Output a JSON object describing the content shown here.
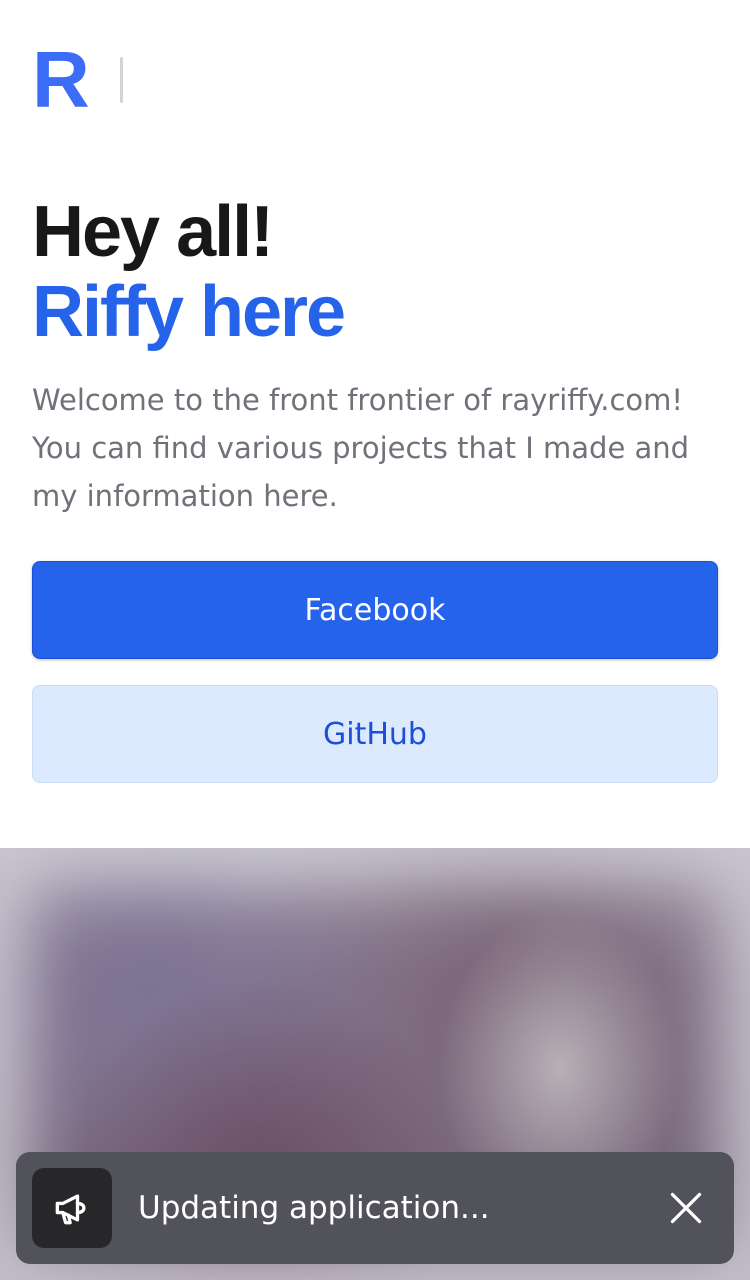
{
  "header": {
    "logo_letter": "R",
    "logo_color": "#3b6df6"
  },
  "hero": {
    "title_line1": "Hey all!",
    "title_line2": "Riffy here",
    "description": "Welcome to the front frontier of rayriffy.com! You can find various projects that I made and my information here."
  },
  "buttons": {
    "facebook_label": "Facebook",
    "github_label": "GitHub"
  },
  "toast": {
    "message": "Updating application...",
    "icon": "megaphone-icon",
    "close_icon": "close-icon"
  },
  "colors": {
    "accent": "#2563eb",
    "accent_light": "#dbeafe",
    "title": "#18181b",
    "muted_text": "#71717a",
    "toast_bg": "#52525b"
  }
}
